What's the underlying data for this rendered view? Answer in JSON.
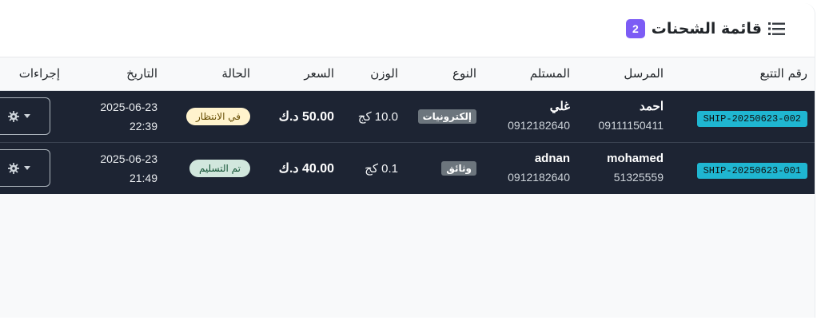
{
  "header": {
    "title": "قائمة الشحنات",
    "count": "2",
    "icon": "list-icon"
  },
  "columns": {
    "tracking": "رقم التتبع",
    "sender": "المرسل",
    "receiver": "المستلم",
    "type": "النوع",
    "weight": "الوزن",
    "price": "السعر",
    "status": "الحالة",
    "date": "التاريخ",
    "actions": "إجراءات"
  },
  "rows": [
    {
      "tracking": "SHIP-20250623-002",
      "sender_name": "احمد",
      "sender_phone": "09111150411",
      "receiver_name": "غلي",
      "receiver_phone": "0912182640",
      "type": "إلكترونيات",
      "weight": "10.0 كج",
      "price": "50.00 د.ك",
      "status": "في الانتظار",
      "date": "2025-06-23",
      "time": "22:39"
    },
    {
      "tracking": "SHIP-20250623-001",
      "sender_name": "mohamed",
      "sender_phone": "51325559",
      "receiver_name": "adnan",
      "receiver_phone": "0912182640",
      "type": "وثائق",
      "weight": "0.1 كج",
      "price": "40.00 د.ك",
      "status": "تم التسليم",
      "date": "2025-06-23",
      "time": "21:49"
    }
  ],
  "colors": {
    "row_bg": "#1d2433",
    "tracking_badge": "#1fb6d1",
    "count_badge": "#7c5cf5",
    "status_pending": "#fff3cd",
    "status_delivered": "#d1e7dd"
  }
}
